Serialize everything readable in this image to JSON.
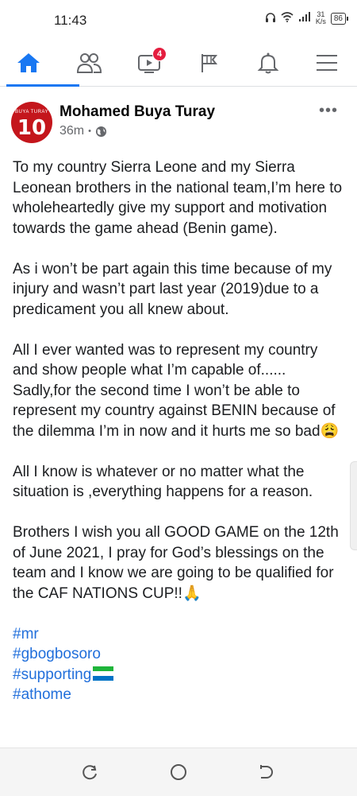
{
  "status_bar": {
    "time": "11:43",
    "net_speed_value": "31",
    "net_speed_unit": "K/s",
    "battery": "86"
  },
  "nav": {
    "items": [
      {
        "name": "home",
        "icon": "home-icon",
        "active": true
      },
      {
        "name": "friends",
        "icon": "friends-icon"
      },
      {
        "name": "watch",
        "icon": "video-icon",
        "badge": "4"
      },
      {
        "name": "pages",
        "icon": "flag-icon"
      },
      {
        "name": "notifications",
        "icon": "bell-icon"
      },
      {
        "name": "menu",
        "icon": "menu-icon"
      }
    ],
    "watch_badge": "4",
    "accent": "#1877f2"
  },
  "post": {
    "author": "Mohamed Buya Turay",
    "time": "36m",
    "separator": "•",
    "avatar_number": "10",
    "avatar_caption": "BUYA TURAY",
    "more": "•••",
    "paragraphs": [
      "To my country Sierra Leone and my Sierra Leonean brothers in the national team,I’m here to wholeheartedly give my support and motivation towards the game ahead (Benin game).",
      "As i won’t be part again this time because of my injury and wasn’t part last year (2019)due to a predicament you all knew about.",
      "All I ever wanted was to represent my country and show people what I’m capable of...... Sadly,for the second time I won’t be able to represent my country against BENIN because of the dilemma I’m in now and it hurts me so bad😩",
      "All I know is whatever or no matter what the situation is ,everything happens for a reason.",
      "Brothers I wish you all GOOD GAME on the 12th of June 2021, I pray for God’s blessings on the team and I know we are going to be qualified for the CAF NATIONS CUP!!🙏"
    ],
    "hashtags": [
      "#mr",
      "#gbogbosoro",
      "#supporting",
      "#athome"
    ],
    "link_color": "#216fdb"
  }
}
